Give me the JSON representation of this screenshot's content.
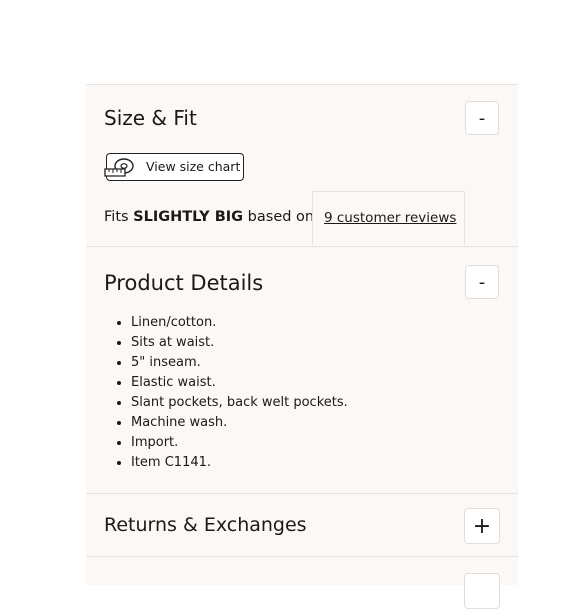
{
  "size_fit": {
    "title": "Size & Fit",
    "toggle_symbol": "-",
    "size_chart_label": "View size chart",
    "size_chart_icon": "measuring-tape-icon",
    "fit_prefix": "Fits",
    "fit_value": "SLIGHTLY BIG",
    "fit_suffix": "based on",
    "reviews_link": "9 customer reviews"
  },
  "product_details": {
    "title": "Product Details",
    "toggle_symbol": "-",
    "items": [
      "Linen/cotton.",
      "Sits at waist.",
      "5\" inseam.",
      "Elastic waist.",
      "Slant pockets, back welt pockets.",
      "Machine wash.",
      "Import.",
      "Item C1141."
    ]
  },
  "returns": {
    "title": "Returns & Exchanges",
    "toggle_symbol": "+"
  }
}
